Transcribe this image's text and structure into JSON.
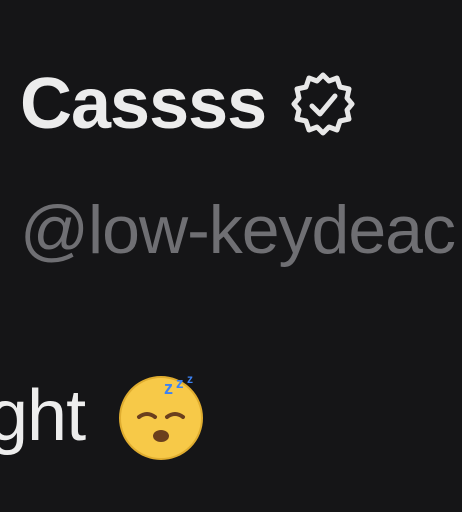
{
  "profile": {
    "display_name": "Cassss",
    "handle": "@low-keydeac",
    "verified_icon": "verified-badge-icon"
  },
  "post": {
    "text_fragment": "ght",
    "emoji": "sleeping-face-emoji"
  },
  "colors": {
    "background": "#151517",
    "name_text": "#ececec",
    "handle_text": "#6f6f73",
    "emoji_yellow": "#f7c948",
    "emoji_blue": "#3b82f6"
  }
}
